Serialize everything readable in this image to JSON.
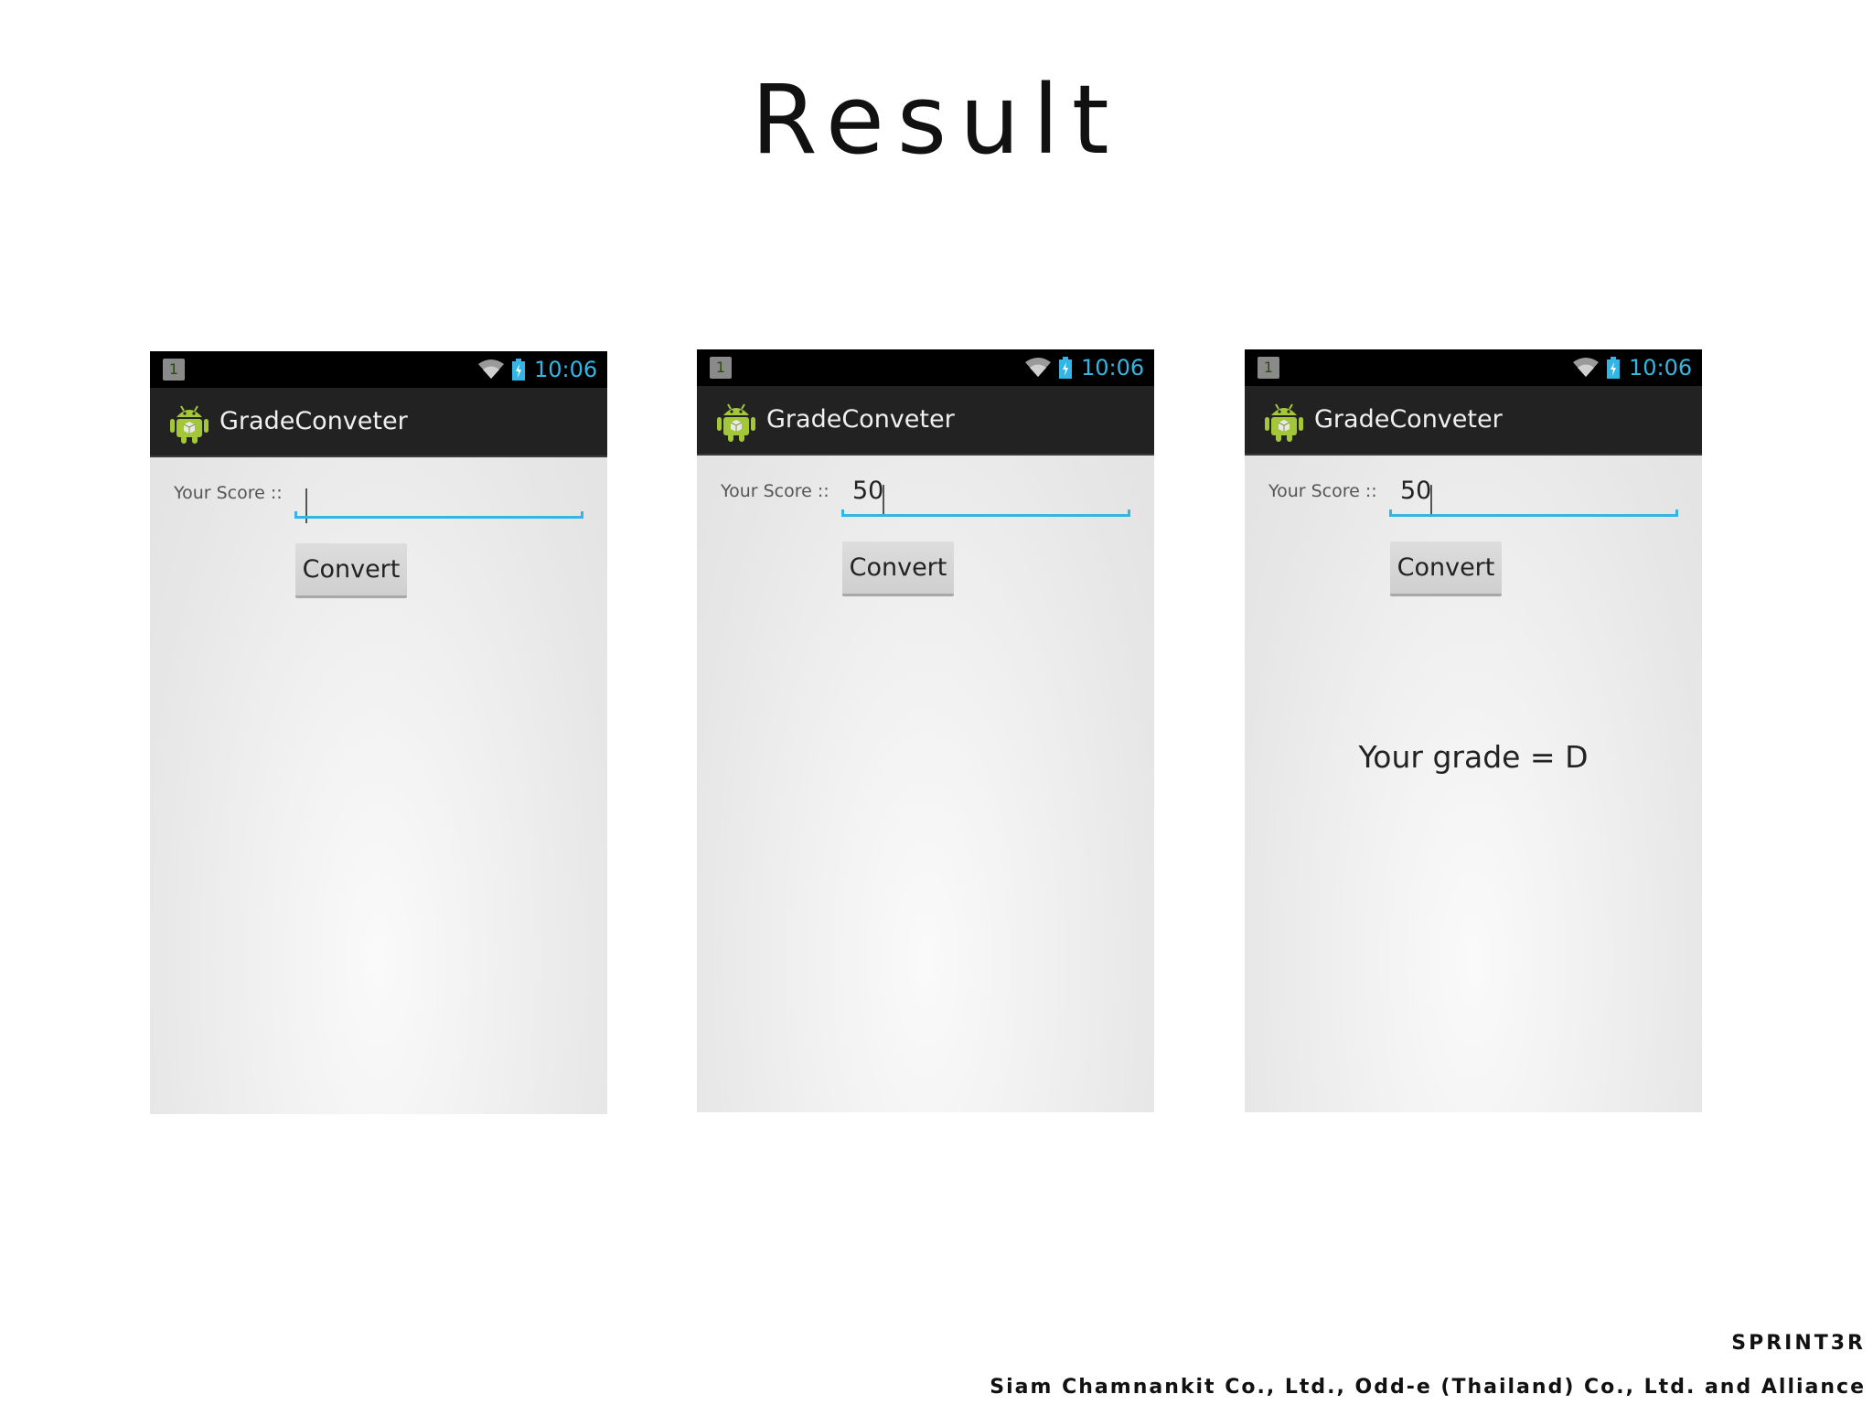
{
  "slide": {
    "title": "Result",
    "brand": "SPRINT3R",
    "credits": "Siam Chamnankit Co., Ltd., Odd-e (Thailand) Co., Ltd. and Alliance"
  },
  "icons": {
    "notification": "notification-1-icon",
    "wifi": "wifi-icon",
    "battery": "battery-icon",
    "app": "android-robot-icon"
  },
  "colors": {
    "accent": "#33b5e5",
    "status_bar": "#000000",
    "action_bar": "#222222",
    "app_icon": "#a4c639"
  },
  "screens": [
    {
      "status": {
        "notification_badge": "1",
        "time": "10:06"
      },
      "app_title": "GradeConveter",
      "score_label": "Your Score ::",
      "score_value": "",
      "convert_label": "Convert",
      "grade_text": ""
    },
    {
      "status": {
        "notification_badge": "1",
        "time": "10:06"
      },
      "app_title": "GradeConveter",
      "score_label": "Your Score ::",
      "score_value": "50",
      "convert_label": "Convert",
      "grade_text": ""
    },
    {
      "status": {
        "notification_badge": "1",
        "time": "10:06"
      },
      "app_title": "GradeConveter",
      "score_label": "Your Score ::",
      "score_value": "50",
      "convert_label": "Convert",
      "grade_text": "Your grade = D"
    }
  ]
}
